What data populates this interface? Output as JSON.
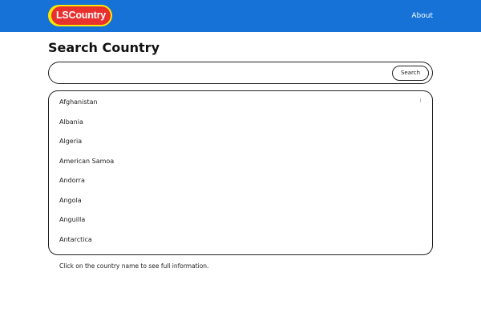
{
  "brand": {
    "logo_text": "LSCountry",
    "colors": {
      "navbar": "#1672d6",
      "logo_outer": "#ffe600",
      "logo_inner": "#e8312f"
    }
  },
  "nav": {
    "about_label": "About"
  },
  "page": {
    "title": "Search Country"
  },
  "search": {
    "value": "",
    "placeholder": "",
    "button_label": "Search"
  },
  "countries": [
    "Afghanistan",
    "Albania",
    "Algeria",
    "American Samoa",
    "Andorra",
    "Angola",
    "Anguilla",
    "Antarctica"
  ],
  "hint": "Click on the country name to see full information."
}
